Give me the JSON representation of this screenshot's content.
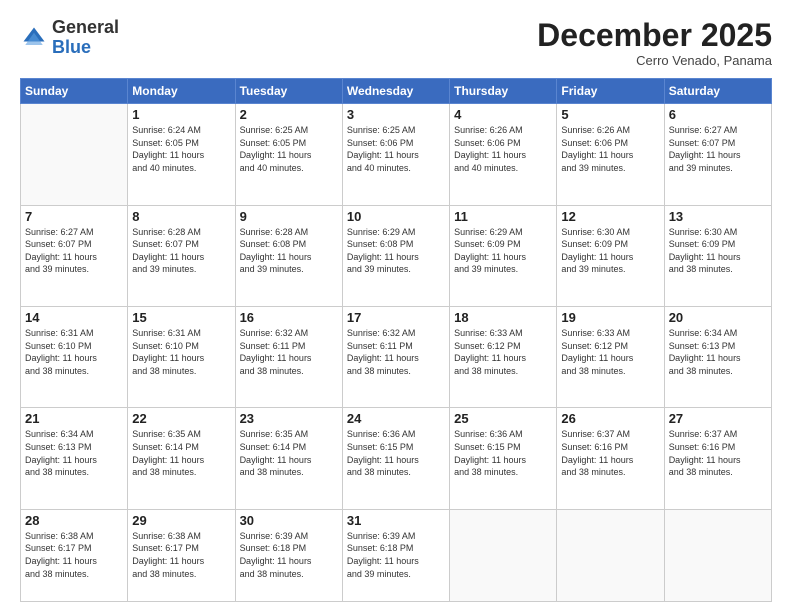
{
  "logo": {
    "general": "General",
    "blue": "Blue"
  },
  "header": {
    "month": "December 2025",
    "location": "Cerro Venado, Panama"
  },
  "weekdays": [
    "Sunday",
    "Monday",
    "Tuesday",
    "Wednesday",
    "Thursday",
    "Friday",
    "Saturday"
  ],
  "weeks": [
    [
      {
        "day": "",
        "info": ""
      },
      {
        "day": "1",
        "info": "Sunrise: 6:24 AM\nSunset: 6:05 PM\nDaylight: 11 hours\nand 40 minutes."
      },
      {
        "day": "2",
        "info": "Sunrise: 6:25 AM\nSunset: 6:05 PM\nDaylight: 11 hours\nand 40 minutes."
      },
      {
        "day": "3",
        "info": "Sunrise: 6:25 AM\nSunset: 6:06 PM\nDaylight: 11 hours\nand 40 minutes."
      },
      {
        "day": "4",
        "info": "Sunrise: 6:26 AM\nSunset: 6:06 PM\nDaylight: 11 hours\nand 40 minutes."
      },
      {
        "day": "5",
        "info": "Sunrise: 6:26 AM\nSunset: 6:06 PM\nDaylight: 11 hours\nand 39 minutes."
      },
      {
        "day": "6",
        "info": "Sunrise: 6:27 AM\nSunset: 6:07 PM\nDaylight: 11 hours\nand 39 minutes."
      }
    ],
    [
      {
        "day": "7",
        "info": "Sunrise: 6:27 AM\nSunset: 6:07 PM\nDaylight: 11 hours\nand 39 minutes."
      },
      {
        "day": "8",
        "info": "Sunrise: 6:28 AM\nSunset: 6:07 PM\nDaylight: 11 hours\nand 39 minutes."
      },
      {
        "day": "9",
        "info": "Sunrise: 6:28 AM\nSunset: 6:08 PM\nDaylight: 11 hours\nand 39 minutes."
      },
      {
        "day": "10",
        "info": "Sunrise: 6:29 AM\nSunset: 6:08 PM\nDaylight: 11 hours\nand 39 minutes."
      },
      {
        "day": "11",
        "info": "Sunrise: 6:29 AM\nSunset: 6:09 PM\nDaylight: 11 hours\nand 39 minutes."
      },
      {
        "day": "12",
        "info": "Sunrise: 6:30 AM\nSunset: 6:09 PM\nDaylight: 11 hours\nand 39 minutes."
      },
      {
        "day": "13",
        "info": "Sunrise: 6:30 AM\nSunset: 6:09 PM\nDaylight: 11 hours\nand 38 minutes."
      }
    ],
    [
      {
        "day": "14",
        "info": "Sunrise: 6:31 AM\nSunset: 6:10 PM\nDaylight: 11 hours\nand 38 minutes."
      },
      {
        "day": "15",
        "info": "Sunrise: 6:31 AM\nSunset: 6:10 PM\nDaylight: 11 hours\nand 38 minutes."
      },
      {
        "day": "16",
        "info": "Sunrise: 6:32 AM\nSunset: 6:11 PM\nDaylight: 11 hours\nand 38 minutes."
      },
      {
        "day": "17",
        "info": "Sunrise: 6:32 AM\nSunset: 6:11 PM\nDaylight: 11 hours\nand 38 minutes."
      },
      {
        "day": "18",
        "info": "Sunrise: 6:33 AM\nSunset: 6:12 PM\nDaylight: 11 hours\nand 38 minutes."
      },
      {
        "day": "19",
        "info": "Sunrise: 6:33 AM\nSunset: 6:12 PM\nDaylight: 11 hours\nand 38 minutes."
      },
      {
        "day": "20",
        "info": "Sunrise: 6:34 AM\nSunset: 6:13 PM\nDaylight: 11 hours\nand 38 minutes."
      }
    ],
    [
      {
        "day": "21",
        "info": "Sunrise: 6:34 AM\nSunset: 6:13 PM\nDaylight: 11 hours\nand 38 minutes."
      },
      {
        "day": "22",
        "info": "Sunrise: 6:35 AM\nSunset: 6:14 PM\nDaylight: 11 hours\nand 38 minutes."
      },
      {
        "day": "23",
        "info": "Sunrise: 6:35 AM\nSunset: 6:14 PM\nDaylight: 11 hours\nand 38 minutes."
      },
      {
        "day": "24",
        "info": "Sunrise: 6:36 AM\nSunset: 6:15 PM\nDaylight: 11 hours\nand 38 minutes."
      },
      {
        "day": "25",
        "info": "Sunrise: 6:36 AM\nSunset: 6:15 PM\nDaylight: 11 hours\nand 38 minutes."
      },
      {
        "day": "26",
        "info": "Sunrise: 6:37 AM\nSunset: 6:16 PM\nDaylight: 11 hours\nand 38 minutes."
      },
      {
        "day": "27",
        "info": "Sunrise: 6:37 AM\nSunset: 6:16 PM\nDaylight: 11 hours\nand 38 minutes."
      }
    ],
    [
      {
        "day": "28",
        "info": "Sunrise: 6:38 AM\nSunset: 6:17 PM\nDaylight: 11 hours\nand 38 minutes."
      },
      {
        "day": "29",
        "info": "Sunrise: 6:38 AM\nSunset: 6:17 PM\nDaylight: 11 hours\nand 38 minutes."
      },
      {
        "day": "30",
        "info": "Sunrise: 6:39 AM\nSunset: 6:18 PM\nDaylight: 11 hours\nand 38 minutes."
      },
      {
        "day": "31",
        "info": "Sunrise: 6:39 AM\nSunset: 6:18 PM\nDaylight: 11 hours\nand 39 minutes."
      },
      {
        "day": "",
        "info": ""
      },
      {
        "day": "",
        "info": ""
      },
      {
        "day": "",
        "info": ""
      }
    ]
  ]
}
